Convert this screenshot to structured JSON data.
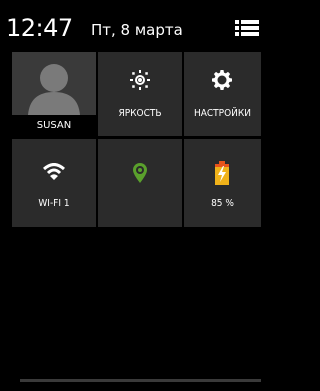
{
  "status": {
    "time": "12:47",
    "date": "Пт, 8 марта"
  },
  "tiles": {
    "user": {
      "name": "SUSAN"
    },
    "brightness": {
      "label": "ЯРКОСТЬ"
    },
    "settings": {
      "label": "НАСТРОЙКИ"
    },
    "wifi": {
      "label": "WI-FI 1"
    },
    "location": {
      "label": ""
    },
    "battery": {
      "label": "85 %",
      "level_percent": 85
    }
  },
  "colors": {
    "tile": "#2b2b2b",
    "location_green": "#5aa02c",
    "battery_orange": "#e8541c",
    "battery_body": "#f0b21a"
  },
  "icons": {
    "menu": "menu-icon",
    "avatar": "avatar-icon",
    "brightness": "brightness-icon",
    "settings": "gear-icon",
    "wifi": "wifi-icon",
    "location": "location-icon",
    "battery": "battery-charging-icon"
  }
}
